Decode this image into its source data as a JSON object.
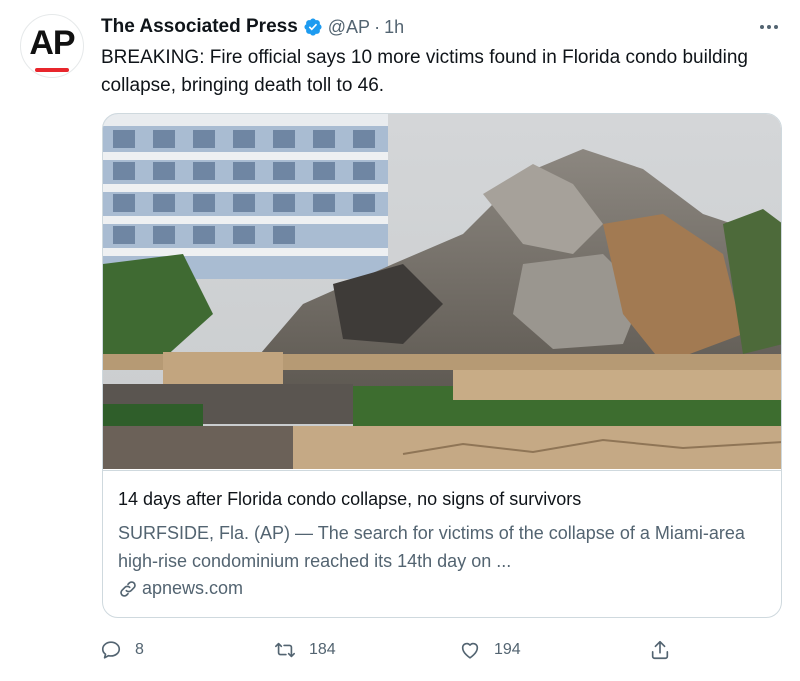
{
  "tweet": {
    "author_name": "The Associated Press",
    "handle": "@AP",
    "separator": "·",
    "time": "1h",
    "text": "BREAKING: Fire official says 10 more victims found in Florida condo building collapse, bringing death toll to 46.",
    "avatar_text": "AP"
  },
  "card": {
    "title": "14 days after Florida condo collapse, no signs of survivors",
    "description": "SURFSIDE, Fla. (AP) — The search for victims of the collapse of a Miami-area high-rise condominium reached its 14th day on ...",
    "domain": "apnews.com"
  },
  "actions": {
    "replies": "8",
    "retweets": "184",
    "likes": "194"
  },
  "colors": {
    "verified": "#1d9bf0",
    "muted_text": "#536471",
    "border": "#cfd9de",
    "ap_red": "#e8262c"
  },
  "icons": [
    "verified-badge-icon",
    "more-icon",
    "link-icon",
    "reply-icon",
    "retweet-icon",
    "like-icon",
    "share-icon"
  ]
}
